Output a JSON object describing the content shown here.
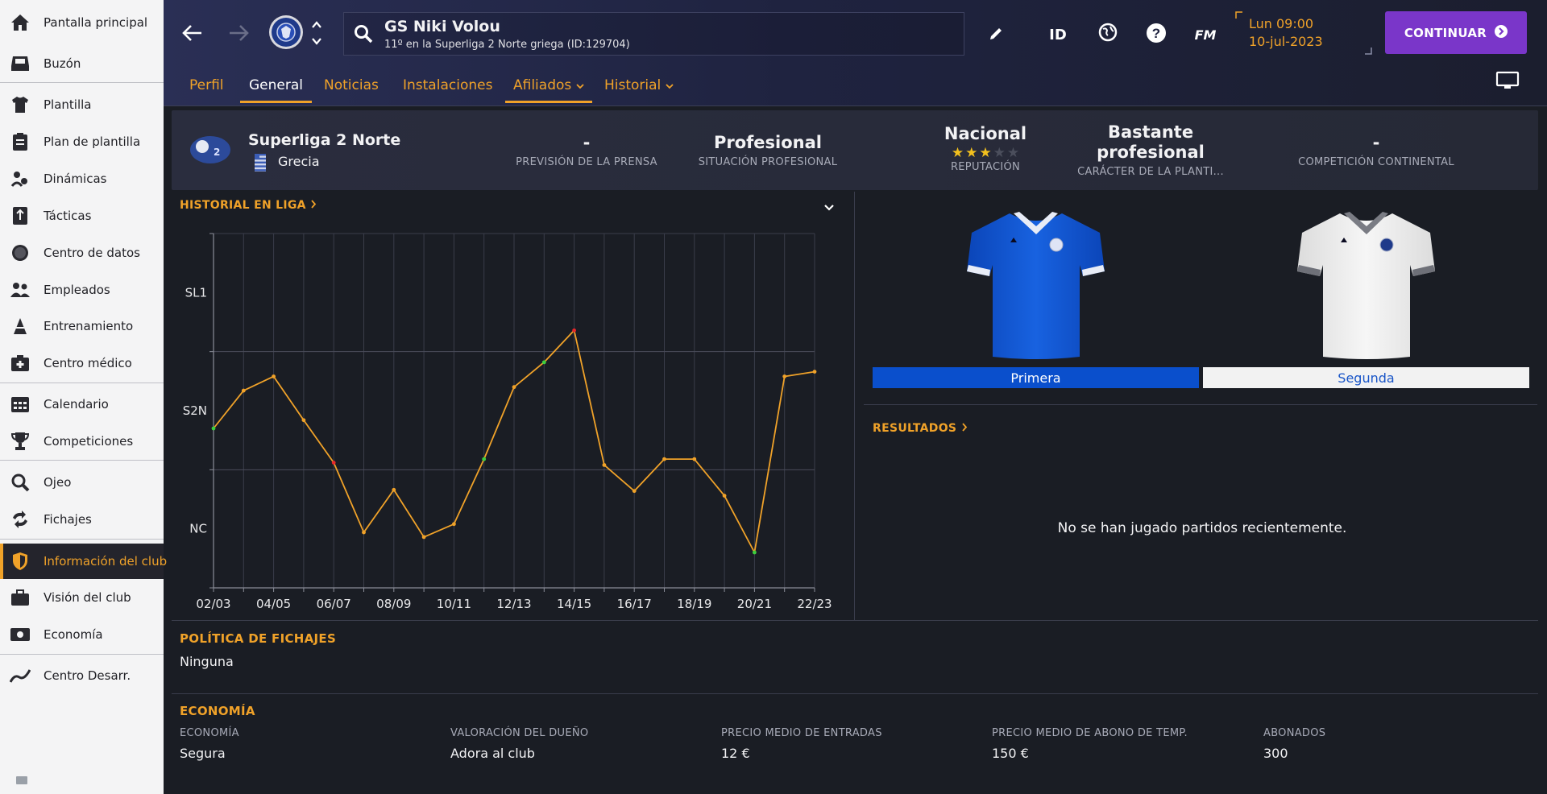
{
  "sidebar": {
    "items": [
      {
        "label": "Pantalla principal",
        "icon": "home-icon"
      },
      {
        "label": "Buzón",
        "icon": "inbox-icon"
      },
      {
        "label": "Plantilla",
        "icon": "shirt-icon"
      },
      {
        "label": "Plan de plantilla",
        "icon": "clipboard-icon"
      },
      {
        "label": "Dinámicas",
        "icon": "dynamics-icon"
      },
      {
        "label": "Tácticas",
        "icon": "tactics-icon"
      },
      {
        "label": "Centro de datos",
        "icon": "data-centre-icon"
      },
      {
        "label": "Empleados",
        "icon": "staff-icon"
      },
      {
        "label": "Entrenamiento",
        "icon": "training-icon"
      },
      {
        "label": "Centro médico",
        "icon": "medical-icon"
      },
      {
        "label": "Calendario",
        "icon": "calendar-icon"
      },
      {
        "label": "Competiciones",
        "icon": "trophy-icon"
      },
      {
        "label": "Ojeo",
        "icon": "scouting-icon"
      },
      {
        "label": "Fichajes",
        "icon": "transfers-icon"
      },
      {
        "label": "Información del club",
        "icon": "club-shield-icon"
      },
      {
        "label": "Visión del club",
        "icon": "briefcase-icon"
      },
      {
        "label": "Economía",
        "icon": "finances-icon"
      },
      {
        "label": "Centro Desarr.",
        "icon": "development-icon"
      }
    ]
  },
  "header": {
    "club_name": "GS Niki Volou",
    "club_subtitle": "11º en la Superliga 2 Norte griega (ID:129704)",
    "id_label": "ID",
    "fm_label": "FM",
    "date_line1": "Lun 09:00",
    "date_line2": "10-jul-2023",
    "continue_label": "CONTINUAR",
    "tabs": [
      "Perfil",
      "General",
      "Noticias",
      "Instalaciones",
      "Afiliados",
      "Historial"
    ]
  },
  "summary": {
    "league_name": "Superliga 2 Norte",
    "country": "Grecia",
    "press_prediction_value": "-",
    "press_prediction_label": "PREVISIÓN DE LA PRENSA",
    "professional_status_value": "Profesional",
    "professional_status_label": "SITUACIÓN PROFESIONAL",
    "reputation_value": "Nacional",
    "reputation_label": "REPUTACIÓN",
    "reputation_stars": 3,
    "reputation_stars_max": 5,
    "squad_character_value": "Bastante profesional",
    "squad_character_label": "CARÁCTER DE LA PLANTI...",
    "continental_value": "-",
    "continental_label": "COMPETICIÓN CONTINENTAL"
  },
  "league_history": {
    "title": "HISTORIAL EN LIGA"
  },
  "chart_data": {
    "type": "line",
    "title": "HISTORIAL EN LIGA",
    "x_tick_labels": [
      "02/03",
      "04/05",
      "06/07",
      "08/09",
      "10/11",
      "12/13",
      "14/15",
      "16/17",
      "18/19",
      "20/21",
      "22/23"
    ],
    "y_tick_labels": [
      "SL1",
      "S2N",
      "NC"
    ],
    "x": [
      "02/03",
      "03/04",
      "04/05",
      "05/06",
      "06/07",
      "07/08",
      "08/09",
      "09/10",
      "10/11",
      "11/12",
      "12/13",
      "13/14",
      "14/15",
      "15/16",
      "16/17",
      "17/18",
      "18/19",
      "19/20",
      "20/21",
      "21/22",
      "22/23"
    ],
    "y": [
      2.15,
      1.83,
      1.71,
      2.08,
      2.44,
      3.03,
      2.67,
      3.07,
      2.96,
      2.41,
      1.8,
      1.59,
      1.32,
      2.46,
      2.68,
      2.41,
      2.41,
      2.72,
      3.2,
      1.71,
      1.67
    ],
    "y_axis_note": "tier levels, lower is better; SL1 = 1, S2N = 2, NC = 3",
    "ylim": [
      0.5,
      3.5
    ],
    "point_colors": {
      "0": "#3ecf3e",
      "4": "#e8282a",
      "9": "#3ecf3e",
      "11": "#3ecf3e",
      "12": "#e8282a",
      "18": "#3ecf3e"
    },
    "line_color": "#f0a229",
    "grid": true
  },
  "kits": {
    "home_label": "Primera",
    "away_label": "Segunda",
    "home_color": "#0a4fcc",
    "away_color": "#f2f2f2"
  },
  "results": {
    "title": "RESULTADOS",
    "empty_text": "No se han jugado partidos recientemente."
  },
  "transfer_policy": {
    "title": "POLÍTICA DE FICHAJES",
    "value": "Ninguna"
  },
  "economy": {
    "title": "ECONOMÍA",
    "fields": [
      {
        "label": "ECONOMÍA",
        "value": "Segura"
      },
      {
        "label": "VALORACIÓN DEL DUEÑO",
        "value": "Adora al club"
      },
      {
        "label": "PRECIO MEDIO DE ENTRADAS",
        "value": "12 €"
      },
      {
        "label": "PRECIO MEDIO DE ABONO DE TEMP.",
        "value": "150 €"
      },
      {
        "label": "ABONADOS",
        "value": "300"
      }
    ]
  },
  "colors": {
    "accent": "#f0a229",
    "background": "#1a1d24",
    "continue_button": "#7a36c9"
  }
}
